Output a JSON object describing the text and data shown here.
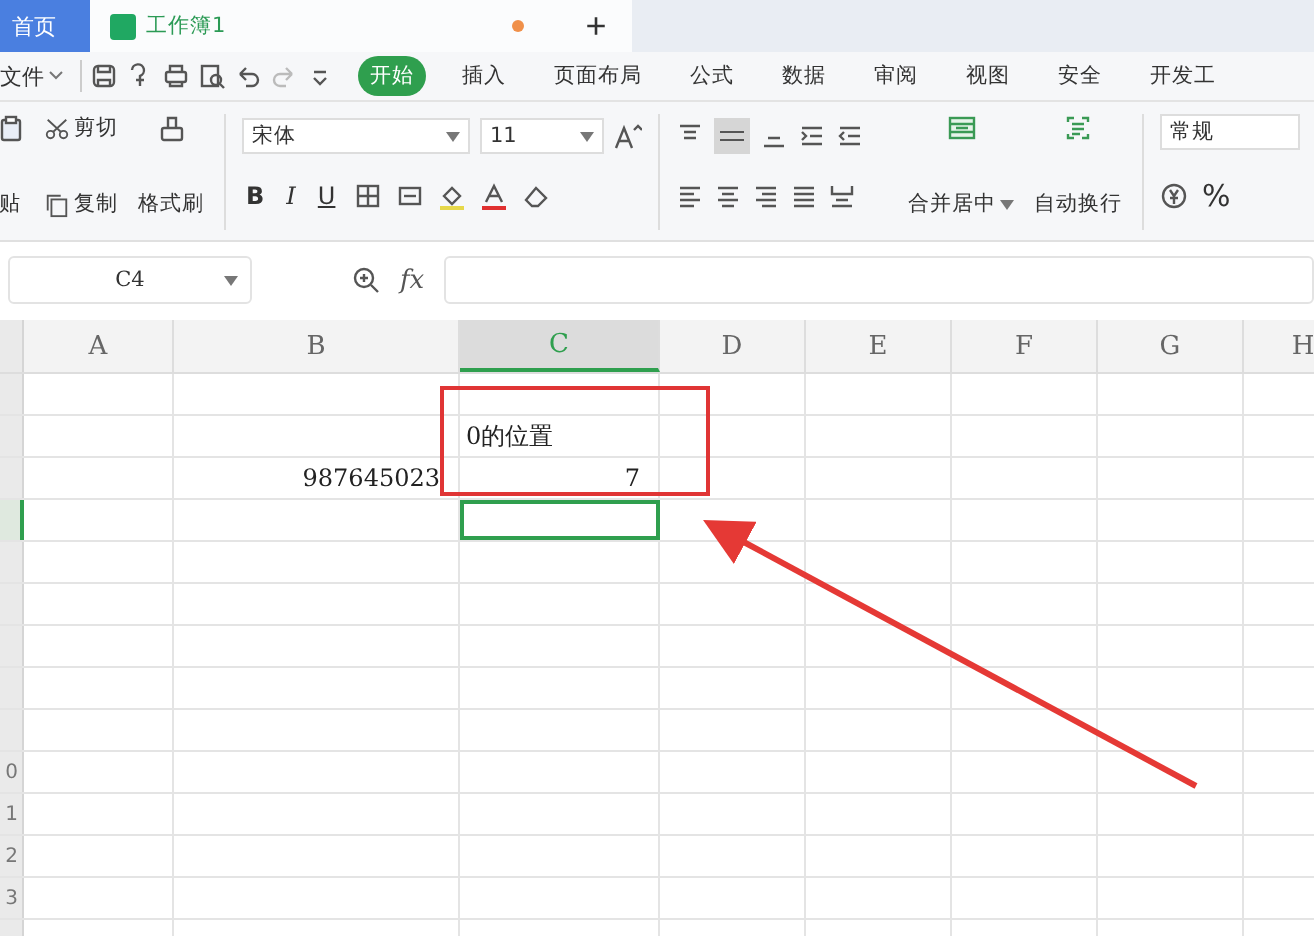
{
  "tabs": [
    {
      "kind": "home",
      "label": "首页",
      "selected": false
    },
    {
      "kind": "doc",
      "label": "工作簿1",
      "selected": true,
      "modified": true
    }
  ],
  "new_tab": "+",
  "menu": {
    "file": "文件",
    "items": [
      {
        "label": "开始",
        "selected": true
      },
      {
        "label": "插入",
        "selected": false
      },
      {
        "label": "页面布局",
        "selected": false
      },
      {
        "label": "公式",
        "selected": false
      },
      {
        "label": "数据",
        "selected": false
      },
      {
        "label": "审阅",
        "selected": false
      },
      {
        "label": "视图",
        "selected": false
      },
      {
        "label": "安全",
        "selected": false
      },
      {
        "label": "开发工",
        "selected": false
      }
    ]
  },
  "ribbon": {
    "paste": "贴",
    "cut": "剪切",
    "copy": "复制",
    "format_painter": "格式刷",
    "font": "宋体",
    "size": "11",
    "bold": "B",
    "italic": "I",
    "underline": "U",
    "merge": "合并居中",
    "wrap": "自动换行",
    "number_format": "常规",
    "percent": "%"
  },
  "formula_bar": {
    "cell": "C4",
    "fx": "fx"
  },
  "sheet": {
    "columns": [
      {
        "label": "A",
        "selected": false
      },
      {
        "label": "B",
        "selected": false
      },
      {
        "label": "C",
        "selected": true
      },
      {
        "label": "D",
        "selected": false
      },
      {
        "label": "E",
        "selected": false
      },
      {
        "label": "F",
        "selected": false
      },
      {
        "label": "G",
        "selected": false
      },
      {
        "label": "H",
        "selected": false
      }
    ],
    "rows": [
      {
        "selected": false,
        "cells": {}
      },
      {
        "selected": false,
        "cells": {
          "C": {
            "text": "0的位置",
            "kind": "text"
          }
        }
      },
      {
        "selected": false,
        "cells": {
          "B": {
            "text": "987645023",
            "kind": "number"
          },
          "C": {
            "text": "7",
            "kind": "number"
          }
        }
      },
      {
        "selected": true,
        "cells": {
          "C": {
            "active": true
          }
        }
      },
      {
        "selected": false,
        "cells": {}
      },
      {
        "selected": false,
        "cells": {}
      },
      {
        "selected": false,
        "cells": {}
      },
      {
        "selected": false,
        "cells": {}
      },
      {
        "selected": false,
        "cells": {}
      },
      {
        "selected": false,
        "label": "0",
        "cells": {}
      },
      {
        "selected": false,
        "label": "1",
        "cells": {}
      },
      {
        "selected": false,
        "label": "2",
        "cells": {}
      },
      {
        "selected": false,
        "label": "3",
        "cells": {}
      },
      {
        "selected": false,
        "cells": {}
      }
    ]
  },
  "annotations": [
    {
      "kind": "box"
    },
    {
      "kind": "arrow"
    }
  ]
}
